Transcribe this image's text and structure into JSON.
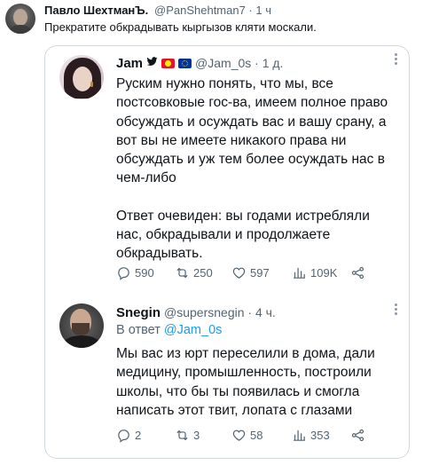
{
  "outer_post": {
    "author_name": "Павло ШехтманЪ.",
    "meta": "@PanShehtman7 · 1 ч",
    "text": "Прекратите обкрадывать кыргызов кляти москали."
  },
  "tweets": [
    {
      "author_name": "Jam",
      "handle_time": "@Jam_0s · 1 д.",
      "paragraphs": [
        "Руским нужно понять, что мы, все постсовковые гос-ва, имеем полное право обсуждать и осуждать вас и вашу срану, а вот вы не имеете никакого права ни обсуждать и уж тем более осуждать нас в чем-либо",
        "Ответ очевиден: вы годами истребляли нас, обкрадывали и продолжаете обкрадывать."
      ],
      "stats": {
        "replies": "590",
        "retweets": "250",
        "likes": "597",
        "views": "109K"
      }
    },
    {
      "author_name": "Snegin",
      "handle_time": "@supersnegin · 4 ч.",
      "reply_prefix": "В ответ",
      "reply_handle": "@Jam_0s",
      "paragraphs": [
        "Мы вас из юрт переселили в дома, дали медицину, промышленность, построили школы, что бы ты появилась и смогла написать этот твит, лопата с глазами"
      ],
      "stats": {
        "replies": "2",
        "retweets": "3",
        "likes": "58",
        "views": "353"
      }
    }
  ],
  "colors": {
    "accent": "#1d9bf0",
    "secondary_text": "#536471",
    "border": "#cfd9de"
  }
}
